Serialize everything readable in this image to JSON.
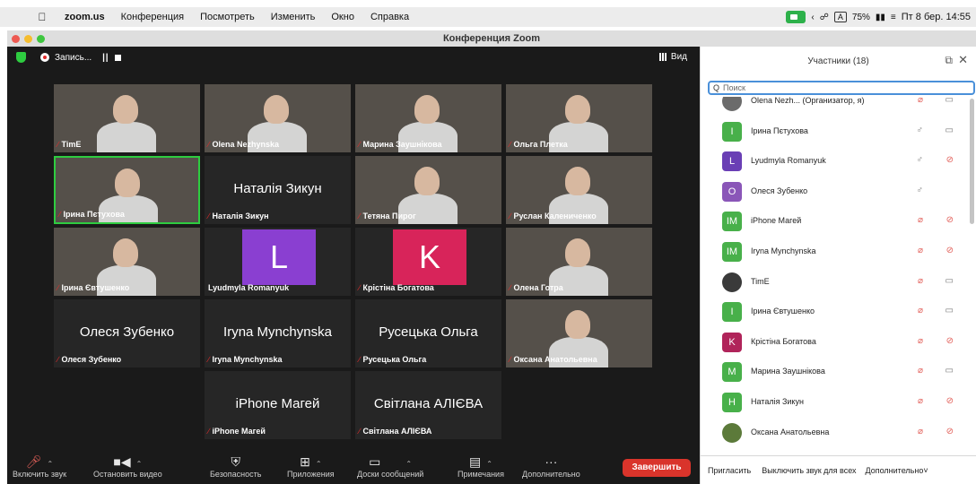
{
  "menubar": {
    "app": "zoom.us",
    "items": [
      "Конференция",
      "Посмотреть",
      "Изменить",
      "Окно",
      "Справка"
    ],
    "battery": "75%",
    "clock": "Пт 8 бер.  14:55"
  },
  "window": {
    "title": "Конференция Zoom"
  },
  "meeting": {
    "recording_label": "Запись...",
    "view_label": "Вид",
    "tiles": [
      {
        "name": "TimE",
        "big": "",
        "avatar": "",
        "video": true
      },
      {
        "name": "Olena Nezhynska",
        "big": "",
        "avatar": "",
        "video": true
      },
      {
        "name": "Марина Заушнікова",
        "big": "",
        "avatar": "",
        "video": true
      },
      {
        "name": "Ольга Плетка",
        "big": "",
        "avatar": "",
        "video": true
      },
      {
        "name": "Ірина Пєтухова",
        "big": "",
        "avatar": "",
        "video": true,
        "active": true
      },
      {
        "name": "Наталія Зикун",
        "big": "Наталія Зикун",
        "avatar": "",
        "video": false
      },
      {
        "name": "Тетяна Пирог",
        "big": "",
        "avatar": "",
        "video": true
      },
      {
        "name": "Руслан Калениченко",
        "big": "",
        "avatar": "",
        "video": true
      },
      {
        "name": "Ірина Євтушенко",
        "big": "",
        "avatar": "",
        "video": true
      },
      {
        "name": "Lyudmyla Romanyuk",
        "big": "",
        "avatar": "L",
        "video": false
      },
      {
        "name": "Крістіна Богатова",
        "big": "",
        "avatar": "K",
        "video": false
      },
      {
        "name": "Олена Готра",
        "big": "",
        "avatar": "",
        "video": true
      },
      {
        "name": "Олеся Зубенко",
        "big": "Олеся Зубенко",
        "avatar": "",
        "video": false
      },
      {
        "name": "Iryna Mynchynska",
        "big": "Iryna Mynchynska",
        "avatar": "",
        "video": false
      },
      {
        "name": "Русецька Ольга",
        "big": "Русецька Ольга",
        "avatar": "",
        "video": false
      },
      {
        "name": "Оксана Анатольевна",
        "big": "",
        "avatar": "",
        "video": true
      },
      {
        "name": "iPhone Магей",
        "big": "iPhone Магей",
        "avatar": "",
        "video": false
      },
      {
        "name": "Світлана АЛІЄВА",
        "big": "Світлана АЛІЄВА",
        "avatar": "",
        "video": false
      }
    ],
    "toolbar": {
      "unmute": "Включить звук",
      "stop_video": "Остановить видео",
      "security": "Безопасность",
      "apps": "Приложения",
      "whiteboards": "Доски сообщений",
      "notes": "Примечания",
      "more": "Дополнительно",
      "end": "Завершить"
    }
  },
  "participants": {
    "title": "Участники (18)",
    "search_placeholder": "Поиск",
    "items": [
      {
        "name": "Olena Nezh...  (Организатор, я)",
        "initials": "",
        "color": "#6b6b6b",
        "mic": "muted",
        "video": "on"
      },
      {
        "name": "Ірина Пєтухова",
        "initials": "І",
        "color": "#48b04a",
        "mic": "on",
        "video": "on"
      },
      {
        "name": "Lyudmyla Romanyuk",
        "initials": "L",
        "color": "#6a3fb5",
        "mic": "on",
        "video": "off"
      },
      {
        "name": "Олеся Зубенко",
        "initials": "О",
        "color": "#8a56b8",
        "mic": "on",
        "video": ""
      },
      {
        "name": "iPhone Магей",
        "initials": "IM",
        "color": "#48b04a",
        "mic": "muted",
        "video": "off"
      },
      {
        "name": "Iryna Mynchynska",
        "initials": "IM",
        "color": "#48b04a",
        "mic": "muted",
        "video": "off"
      },
      {
        "name": "TimE",
        "initials": "",
        "color": "#3a3a3a",
        "mic": "muted",
        "video": "on"
      },
      {
        "name": "Ірина Євтушенко",
        "initials": "І",
        "color": "#48b04a",
        "mic": "muted",
        "video": "on"
      },
      {
        "name": "Крістіна Богатова",
        "initials": "K",
        "color": "#b0245a",
        "mic": "muted",
        "video": "off"
      },
      {
        "name": "Марина Заушнікова",
        "initials": "M",
        "color": "#48b04a",
        "mic": "muted",
        "video": "on"
      },
      {
        "name": "Наталія Зикун",
        "initials": "H",
        "color": "#48b04a",
        "mic": "muted",
        "video": "off"
      },
      {
        "name": "Оксана Анатольевна",
        "initials": "",
        "color": "#5c7a3a",
        "mic": "muted",
        "video": "off"
      }
    ],
    "footer": {
      "invite": "Пригласить",
      "mute_all": "Выключить звук для всех",
      "more": "Дополнительно"
    }
  },
  "colors": {
    "end_button": "#d9342b",
    "active_speaker": "#2ecc40",
    "avatar_L": "#8a3fd1",
    "avatar_K": "#d8245a"
  }
}
